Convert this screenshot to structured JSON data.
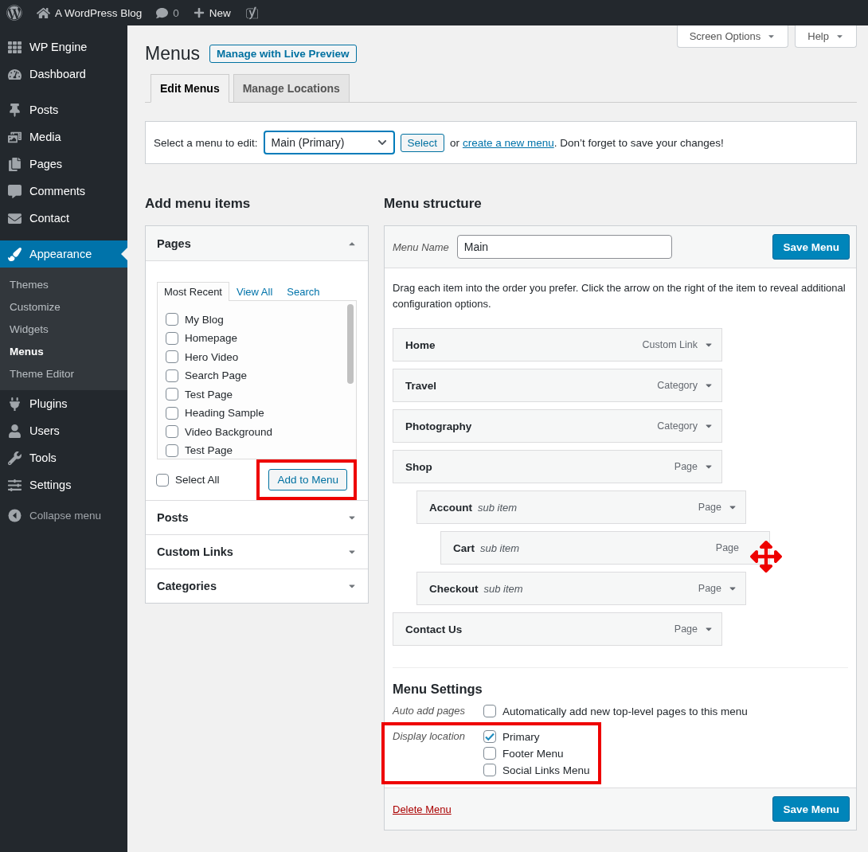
{
  "admin_bar": {
    "site_name": "A WordPress Blog",
    "comments": "0",
    "new_label": "New"
  },
  "sidebar": {
    "groups": [
      [
        {
          "label": "WP Engine",
          "selected": false
        },
        {
          "label": "Dashboard",
          "selected": false
        }
      ],
      [
        {
          "label": "Posts",
          "selected": false
        },
        {
          "label": "Media",
          "selected": false
        },
        {
          "label": "Pages",
          "selected": false
        },
        {
          "label": "Comments",
          "selected": false
        },
        {
          "label": "Contact",
          "selected": false
        }
      ],
      [
        {
          "label": "Appearance",
          "selected": true,
          "submenu": [
            {
              "label": "Themes",
              "selected": false
            },
            {
              "label": "Customize",
              "selected": false
            },
            {
              "label": "Widgets",
              "selected": false
            },
            {
              "label": "Menus",
              "selected": true
            },
            {
              "label": "Theme Editor",
              "selected": false
            }
          ]
        },
        {
          "label": "Plugins",
          "selected": false
        },
        {
          "label": "Users",
          "selected": false
        },
        {
          "label": "Tools",
          "selected": false
        },
        {
          "label": "Settings",
          "selected": false
        }
      ]
    ],
    "collapse_label": "Collapse menu"
  },
  "screen_meta": [
    {
      "label": "Screen Options"
    },
    {
      "label": "Help"
    }
  ],
  "page_title": "Menus",
  "title_action": "Manage with Live Preview",
  "tabs": [
    {
      "label": "Edit Menus",
      "selected": true
    },
    {
      "label": "Manage Locations",
      "selected": false
    }
  ],
  "menu_select": {
    "label": "Select a menu to edit:",
    "value": "Main (Primary)",
    "button": "Select",
    "text_before": "or",
    "link": "create a new menu",
    "text_after": ". Don’t forget to save your changes!"
  },
  "add_items": {
    "heading": "Add menu items",
    "sections": [
      {
        "title": "Pages",
        "expanded": true,
        "tabs": [
          {
            "label": "Most Recent",
            "selected": true
          },
          {
            "label": "View All",
            "selected": false
          },
          {
            "label": "Search",
            "selected": false
          }
        ],
        "items": [
          {
            "label": "My Blog",
            "checked": false
          },
          {
            "label": "Homepage",
            "checked": false
          },
          {
            "label": "Hero Video",
            "checked": false
          },
          {
            "label": "Search Page",
            "checked": false
          },
          {
            "label": "Test Page",
            "checked": false
          },
          {
            "label": "Heading Sample",
            "checked": false
          },
          {
            "label": "Video Background",
            "checked": false
          },
          {
            "label": "Test Page",
            "checked": false
          }
        ],
        "select_all": {
          "label": "Select All",
          "checked": false
        },
        "add_button": {
          "label": "Add to Menu",
          "highlighted": true
        }
      },
      {
        "title": "Posts",
        "expanded": false
      },
      {
        "title": "Custom Links",
        "expanded": false
      },
      {
        "title": "Categories",
        "expanded": false
      }
    ]
  },
  "structure": {
    "heading": "Menu structure",
    "name_label": "Menu Name",
    "name_value": "Main",
    "save": "Save Menu",
    "instructions": "Drag each item into the order you prefer. Click the arrow on the right of the item to reveal additional configuration options.",
    "items": [
      {
        "title": "Home",
        "type": "Custom Link"
      },
      {
        "title": "Travel",
        "type": "Category"
      },
      {
        "title": "Photography",
        "type": "Category"
      },
      {
        "title": "Shop",
        "type": "Page",
        "children": [
          {
            "title": "Account",
            "note": "sub item",
            "type": "Page",
            "children": [
              {
                "title": "Cart",
                "note": "sub item",
                "type": "Page",
                "dragging": true
              }
            ]
          },
          {
            "title": "Checkout",
            "note": "sub item",
            "type": "Page"
          }
        ]
      },
      {
        "title": "Contact Us",
        "type": "Page"
      }
    ],
    "settings": {
      "heading": "Menu Settings",
      "auto_add": {
        "label": "Auto add pages",
        "option": {
          "label": "Automatically add new top-level pages to this menu",
          "checked": false
        }
      },
      "display_location": {
        "label": "Display location",
        "highlighted": true,
        "options": [
          {
            "label": "Primary",
            "checked": true
          },
          {
            "label": "Footer Menu",
            "checked": false
          },
          {
            "label": "Social Links Menu",
            "checked": false
          }
        ]
      }
    },
    "delete": "Delete Menu",
    "save_bottom": "Save Menu"
  }
}
